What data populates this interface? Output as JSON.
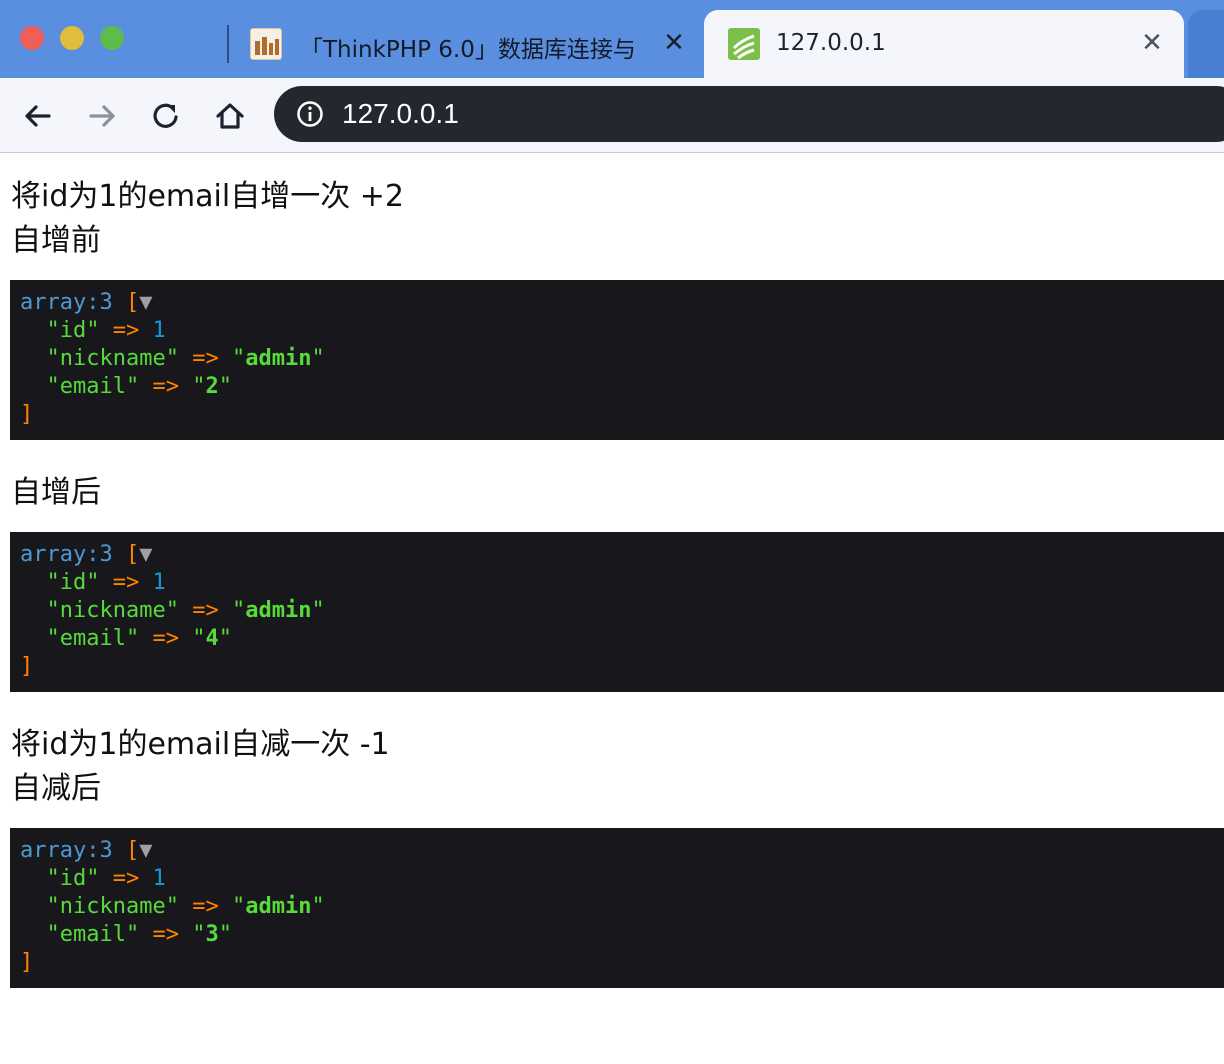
{
  "browser": {
    "tabs": [
      {
        "title": "「ThinkPHP 6.0」数据库连接与",
        "active": false
      },
      {
        "title": "127.0.0.1",
        "active": true
      }
    ],
    "close_glyph": "✕",
    "address": "127.0.0.1",
    "icons": [
      "arrow-left-icon",
      "arrow-right-icon",
      "reload-icon",
      "home-icon",
      "info-icon",
      "close-icon"
    ]
  },
  "page": {
    "line1": "将id为1的email自增一次 +2",
    "line2": "自增前",
    "line3": "自增后",
    "line4": "将id为1的email自减一次 -1",
    "line5": "自减后"
  },
  "dumps": [
    {
      "type_label": "array:3",
      "open": "[",
      "toggle": "▼",
      "close": "]",
      "arrow": "=>",
      "items": [
        {
          "key": "id",
          "value": "1",
          "kind": "number"
        },
        {
          "key": "nickname",
          "value": "admin",
          "kind": "string"
        },
        {
          "key": "email",
          "value": "2",
          "kind": "string"
        }
      ]
    },
    {
      "type_label": "array:3",
      "open": "[",
      "toggle": "▼",
      "close": "]",
      "arrow": "=>",
      "items": [
        {
          "key": "id",
          "value": "1",
          "kind": "number"
        },
        {
          "key": "nickname",
          "value": "admin",
          "kind": "string"
        },
        {
          "key": "email",
          "value": "4",
          "kind": "string"
        }
      ]
    },
    {
      "type_label": "array:3",
      "open": "[",
      "toggle": "▼",
      "close": "]",
      "arrow": "=>",
      "items": [
        {
          "key": "id",
          "value": "1",
          "kind": "number"
        },
        {
          "key": "nickname",
          "value": "admin",
          "kind": "string"
        },
        {
          "key": "email",
          "value": "3",
          "kind": "string"
        }
      ]
    }
  ],
  "colors": {
    "tabstrip": "#5a8fe0",
    "dump_background": "#18171b",
    "dump_key": "#56db3a",
    "dump_number": "#1299da",
    "dump_arrow": "#ff8400",
    "dump_type": "#4d9ad3"
  }
}
